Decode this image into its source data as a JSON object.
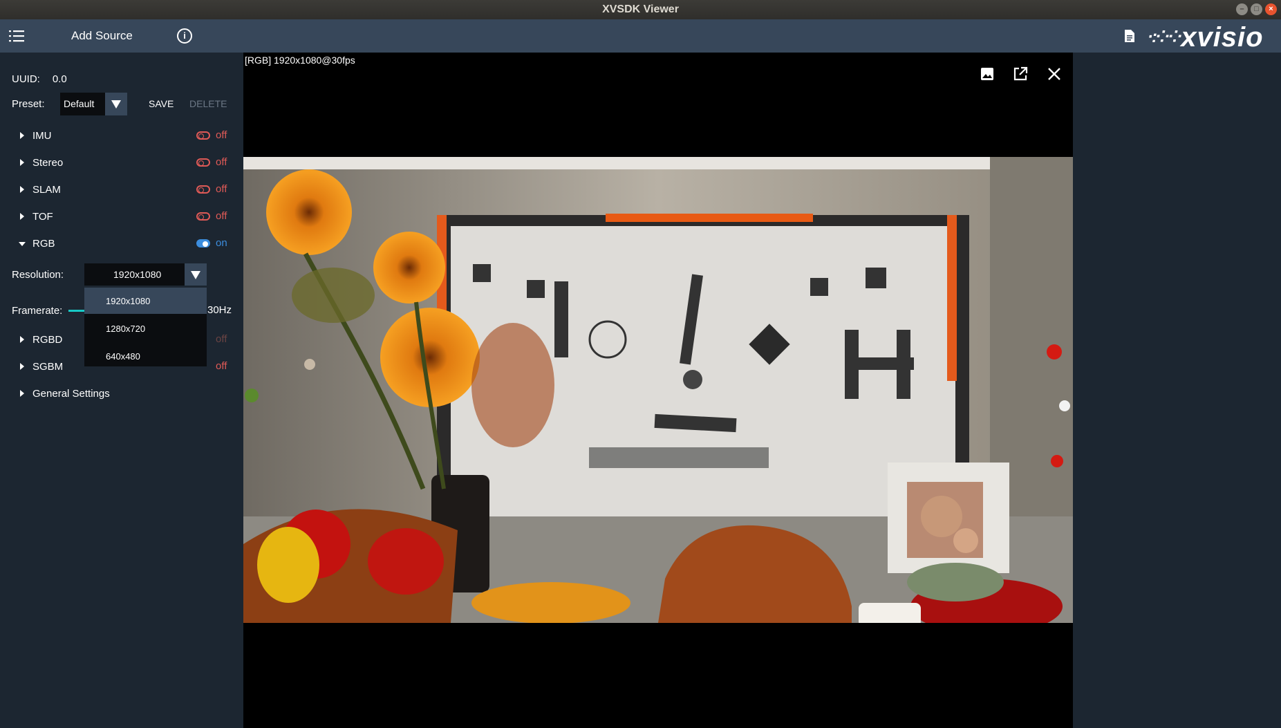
{
  "window": {
    "title": "XVSDK Viewer"
  },
  "toolbar": {
    "add_source": "Add Source",
    "menu_icon": "hamburger-list-icon",
    "info_icon": "info-icon",
    "doc_icon": "document-icon",
    "logo": "xvisio"
  },
  "sidebar": {
    "uuid_label": "UUID:",
    "uuid_value": "0.0",
    "preset_label": "Preset:",
    "preset_value": "Default",
    "save_label": "SAVE",
    "delete_label": "DELETE",
    "sections": [
      {
        "label": "IMU",
        "state": "off"
      },
      {
        "label": "Stereo",
        "state": "off"
      },
      {
        "label": "SLAM",
        "state": "off"
      },
      {
        "label": "TOF",
        "state": "off"
      },
      {
        "label": "RGB",
        "state": "on"
      },
      {
        "label": "RGBD",
        "state": "off"
      },
      {
        "label": "SGBM",
        "state": "off"
      },
      {
        "label": "General Settings"
      }
    ],
    "resolution_label": "Resolution:",
    "resolution_value": "1920x1080",
    "resolution_options": [
      "1920x1080",
      "1280x720",
      "640x480"
    ],
    "framerate_label": "Framerate:",
    "framerate_value": "30Hz"
  },
  "viewer": {
    "stream_label": "[RGB]  1920x1080@30fps",
    "icons": [
      "snapshot-image-icon",
      "popout-window-icon",
      "close-icon"
    ]
  },
  "colors": {
    "accent_on": "#3c8ddd",
    "off": "#e05a57",
    "toolbar": "#37475a",
    "sidebar": "#1c2631",
    "slider": "#17c9c6"
  }
}
